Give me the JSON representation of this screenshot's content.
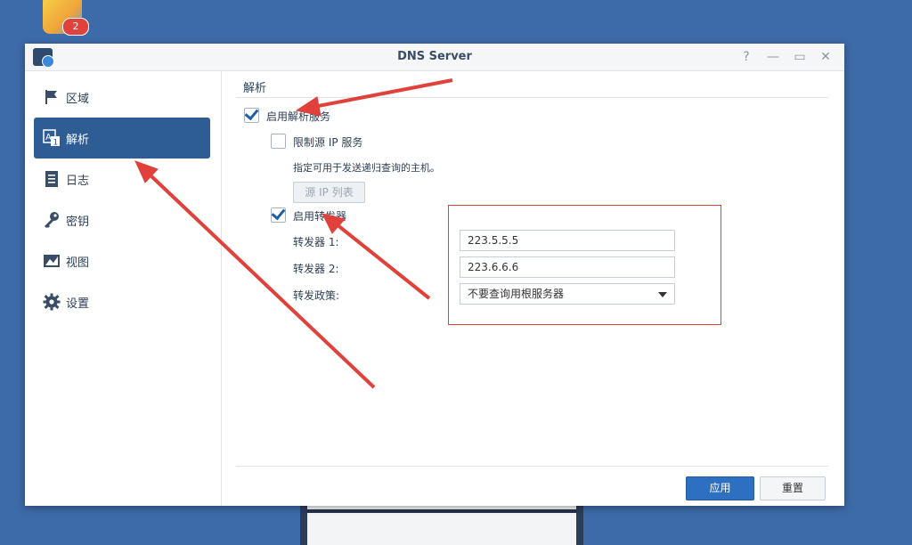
{
  "desktop": {
    "badge_count": "2"
  },
  "window": {
    "title": "DNS Server",
    "controls": {
      "help": "?",
      "minimize": "—",
      "maximize": "▭",
      "close": "✕"
    }
  },
  "sidebar": {
    "items": [
      {
        "label": "区域",
        "icon": "flag-icon"
      },
      {
        "label": "解析",
        "icon": "resolve-icon"
      },
      {
        "label": "日志",
        "icon": "log-icon"
      },
      {
        "label": "密钥",
        "icon": "key-icon"
      },
      {
        "label": "视图",
        "icon": "view-icon"
      },
      {
        "label": "设置",
        "icon": "gear-icon"
      }
    ],
    "active_index": 1
  },
  "resolution": {
    "section_title": "解析",
    "enable_resolution_label": "启用解析服务",
    "enable_resolution_checked": true,
    "limit_source_ip_label": "限制源 IP 服务",
    "limit_source_ip_checked": false,
    "limit_hint": "指定可用于发送递归查询的主机。",
    "source_ip_list_button": "源 IP 列表",
    "enable_forwarders_label": "启用转发器",
    "enable_forwarders_checked": true,
    "forwarder1_label": "转发器 1:",
    "forwarder1_value": "223.5.5.5",
    "forwarder2_label": "转发器 2:",
    "forwarder2_value": "223.6.6.6",
    "policy_label": "转发政策:",
    "policy_value": "不要查询用根服务器"
  },
  "footer": {
    "apply_label": "应用",
    "reset_label": "重置"
  },
  "colors": {
    "accent": "#2d6fc0",
    "annotation_red": "#e0413b",
    "desktop": "#3d6aa8"
  }
}
